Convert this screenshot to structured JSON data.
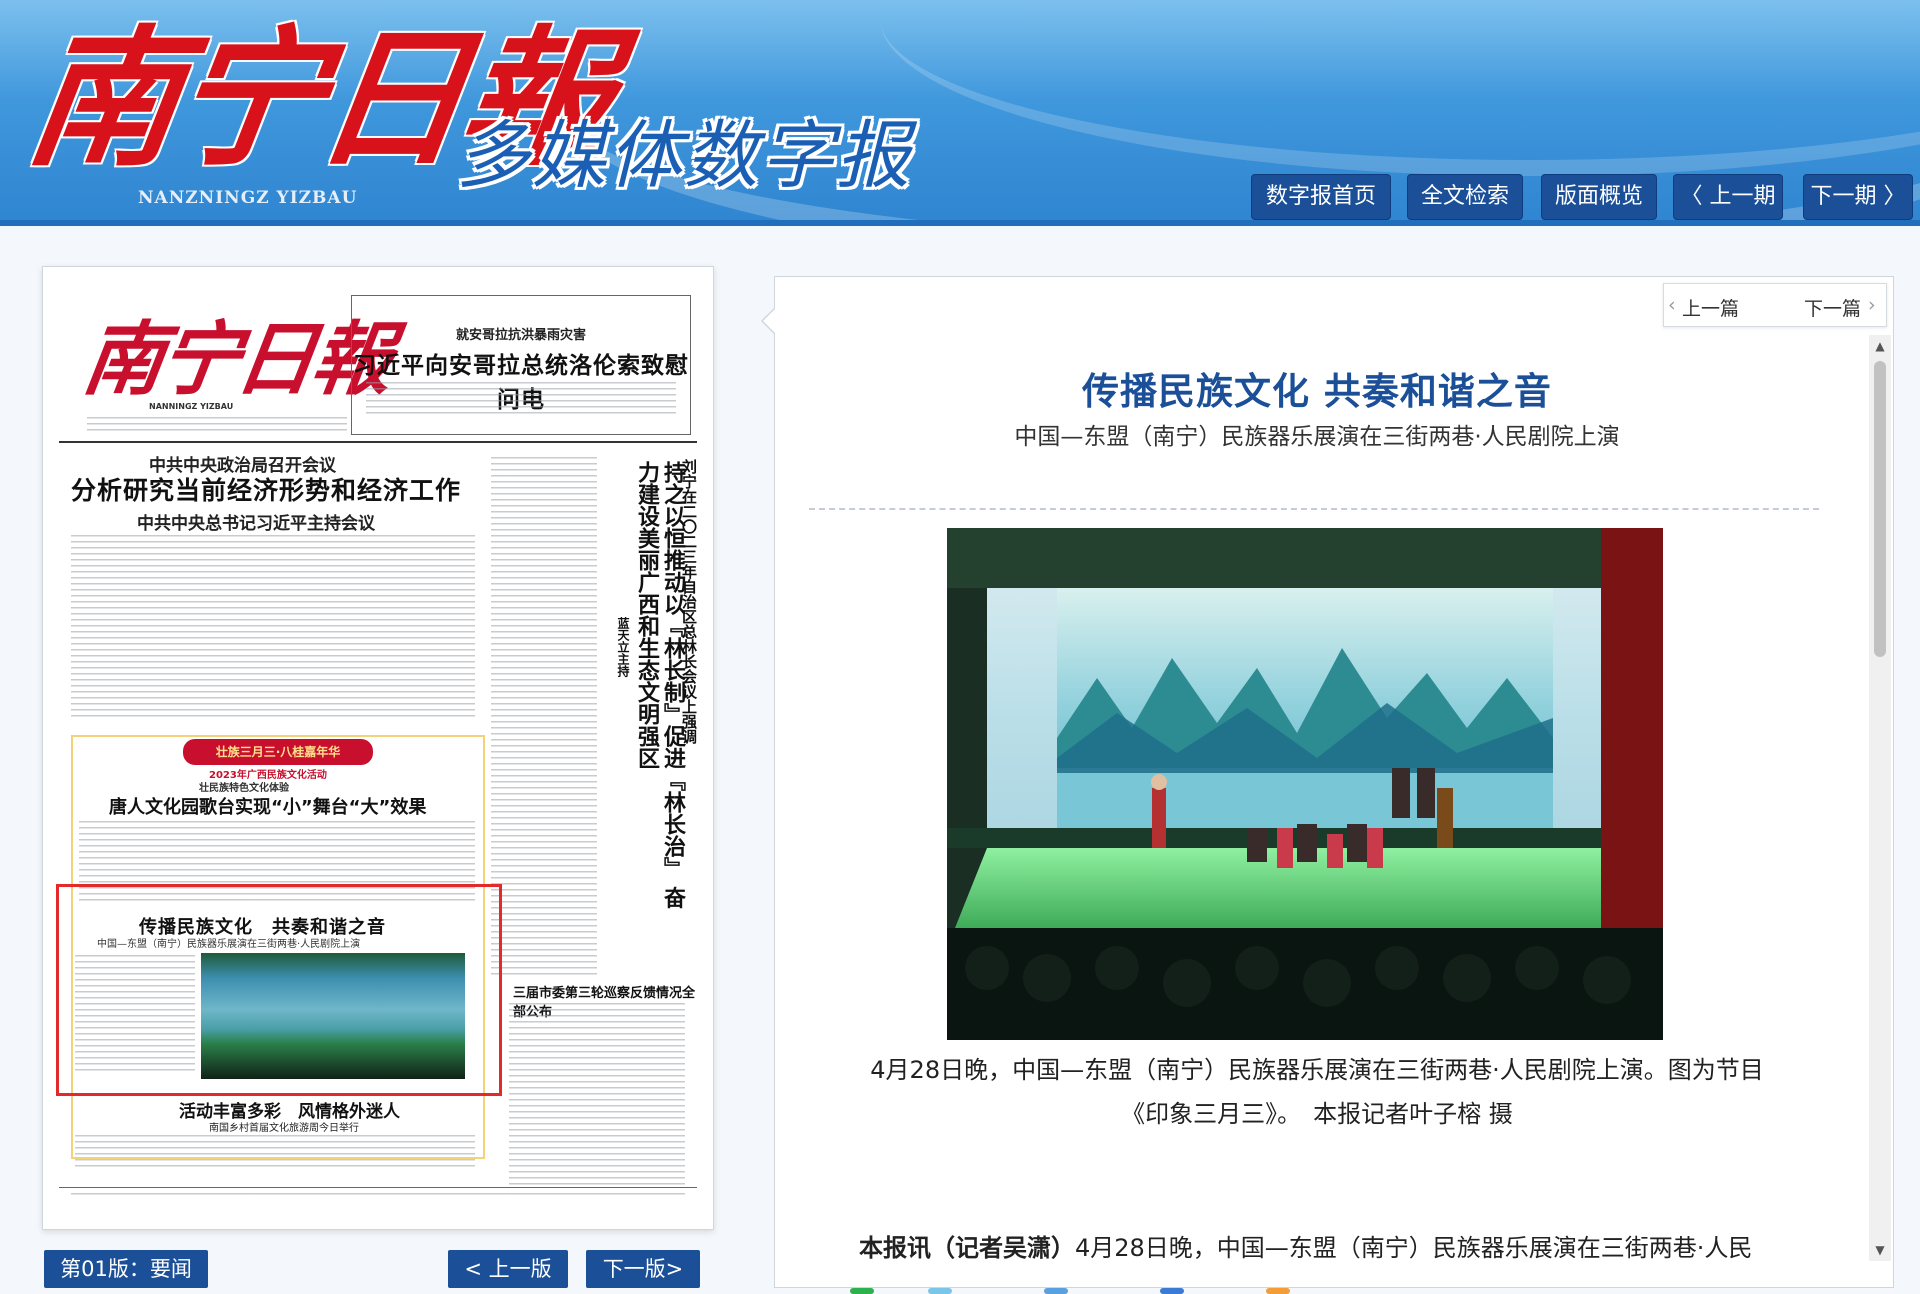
{
  "header": {
    "logo_text": "南宁日報",
    "logo_en": "NANZNINGZ YIZBAU",
    "subtitle": "多媒体数字报",
    "nav": {
      "home": "数字报首页",
      "search": "全文检索",
      "overview": "版面概览",
      "prev_issue": "〈 上一期",
      "next_issue": "下一期 〉"
    }
  },
  "newspaper": {
    "masthead": "南宁日報",
    "masthead_en": "NANNINGZ YIZBAU",
    "top_kicker": "就安哥拉抗洪暴雨灾害",
    "top_headline": "习近平向安哥拉总统洛伦索致慰问电",
    "lead_kicker": "中共中央政治局召开会议",
    "lead_headline": "分析研究当前经济形势和经济工作",
    "lead_sub": "中共中央总书记习近平主持会议",
    "vertical_head": "持之以恒推动以『林长制』促进『林长治』 奋力建设美丽广西和生态文明强区",
    "vertical_kicker": "刘宁在二〇二三年自治区总林长会议上强调",
    "vertical_byline": "蓝天立主持",
    "feature_banner": "壮族三月三·八桂嘉年华",
    "feature_kicker": "2023年广西民族文化活动",
    "feature_kicker2": "壮民族特色文化体验",
    "feature_head": "唐人文化园歌台实现“小”舞台“大”效果",
    "article_head": "传播民族文化　共奏和谐之音",
    "article_sub": "中国—东盟（南宁）民族器乐展演在三街两巷·人民剧院上演",
    "bottom_head": "活动丰富多彩　风情格外迷人",
    "bottom_sub": "南国乡村首届文化旅游周今日举行",
    "right_head": "三届市委第三轮巡察反馈情况全部公布"
  },
  "page_label": "第01版：要闻",
  "pager": {
    "prev": "< 上一版",
    "next": "下一版>"
  },
  "article": {
    "prev": "上一篇",
    "next": "下一篇",
    "title": "传播民族文化 共奏和谐之音",
    "subtitle": "中国—东盟（南宁）民族器乐展演在三街两巷·人民剧院上演",
    "caption_line1": "4月28日晚，中国—东盟（南宁）民族器乐展演在三街两巷·人民剧院上演。图为节目",
    "caption_line2": "《印象三月三》。　本报记者叶子榕 摄",
    "body_lead": "本报讯（记者吴潇）",
    "body_text": "4月28日晚，中国—东盟（南宁）民族器乐展演在三街两巷·人民"
  },
  "colors": {
    "brand_blue": "#1b4f98",
    "title_blue": "#1b4f98",
    "logo_red": "#d8121a",
    "highlight_red": "#e22a2a"
  },
  "icons": {
    "scroll_up": "▲",
    "scroll_down": "▼",
    "prev_arrow": "‹",
    "next_arrow": "›"
  }
}
